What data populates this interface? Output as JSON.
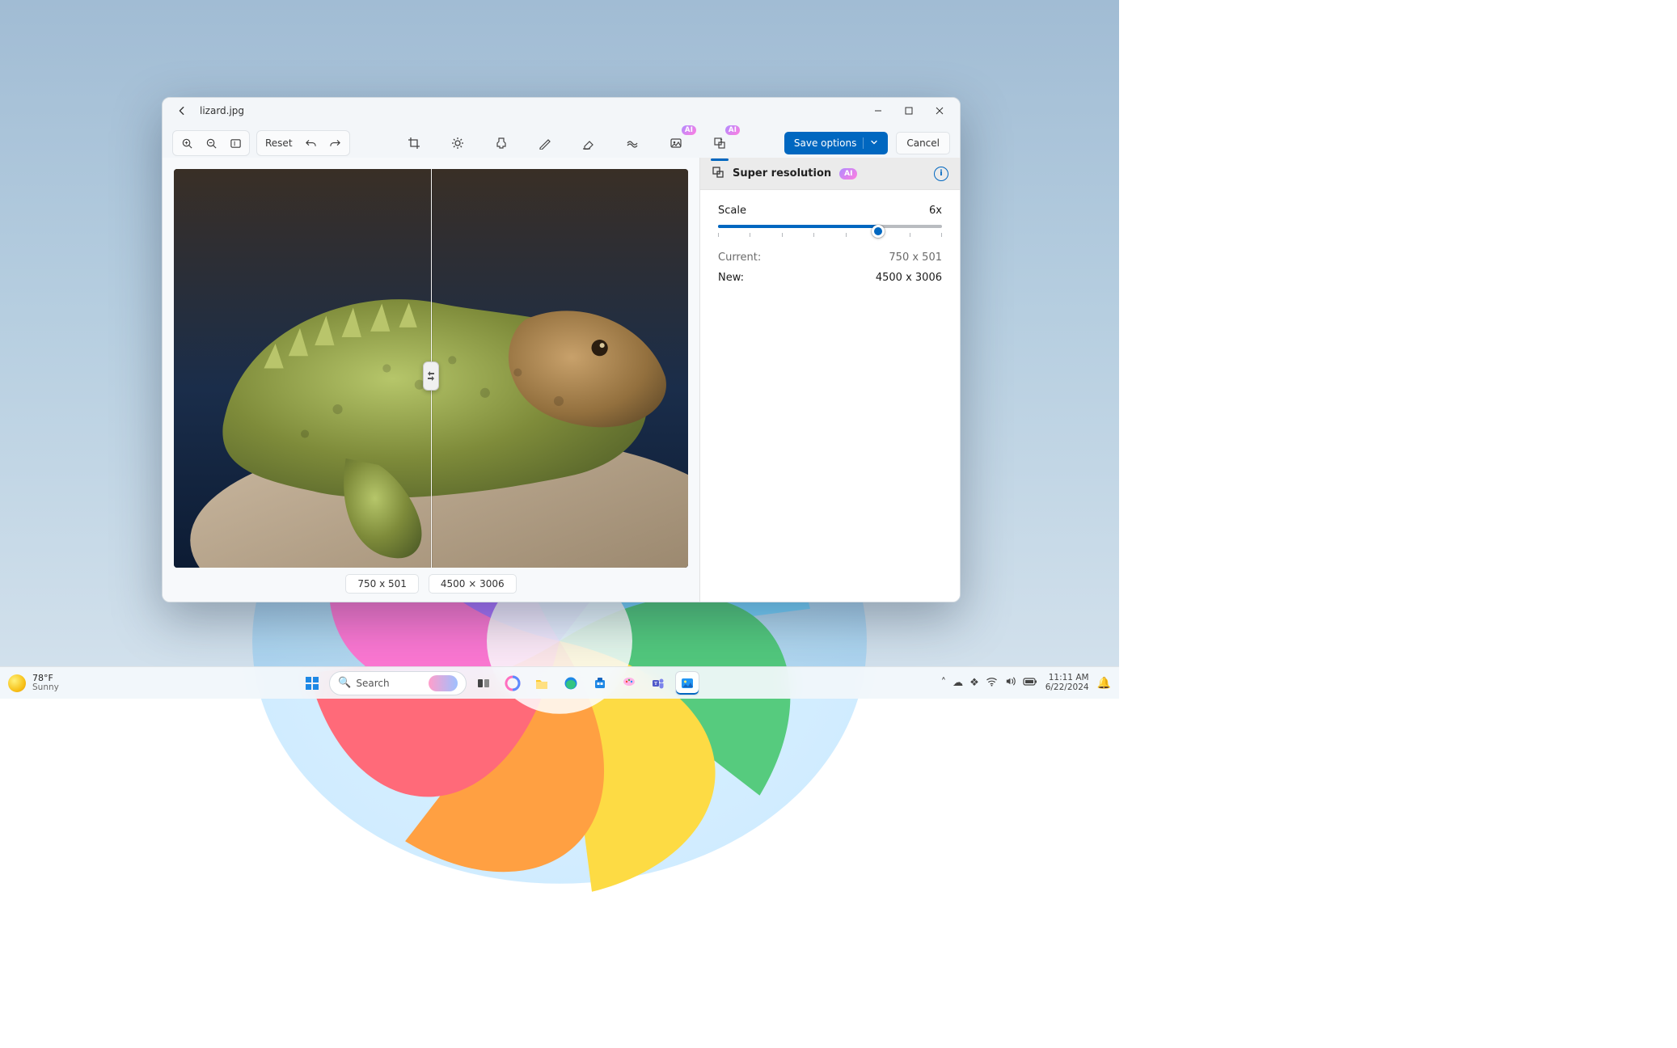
{
  "titlebar": {
    "filename": "lizard.jpg"
  },
  "toolbar": {
    "reset_label": "Reset",
    "save_label": "Save options",
    "cancel_label": "Cancel",
    "ai_badge": "AI"
  },
  "viewer": {
    "split_pct": 50,
    "left_dim": "750 x 501",
    "right_dim": "4500 × 3006"
  },
  "panel": {
    "title": "Super resolution",
    "ai_badge": "AI",
    "scale_label": "Scale",
    "scale_value": "6x",
    "scale_min": 1,
    "scale_max": 8,
    "scale_current": 6,
    "current_label": "Current:",
    "current_value": "750 x 501",
    "new_label": "New:",
    "new_value": "4500 x 3006"
  },
  "taskbar": {
    "weather_temp": "78°F",
    "weather_cond": "Sunny",
    "search_placeholder": "Search",
    "time": "11:11 AM",
    "date": "6/22/2024"
  }
}
